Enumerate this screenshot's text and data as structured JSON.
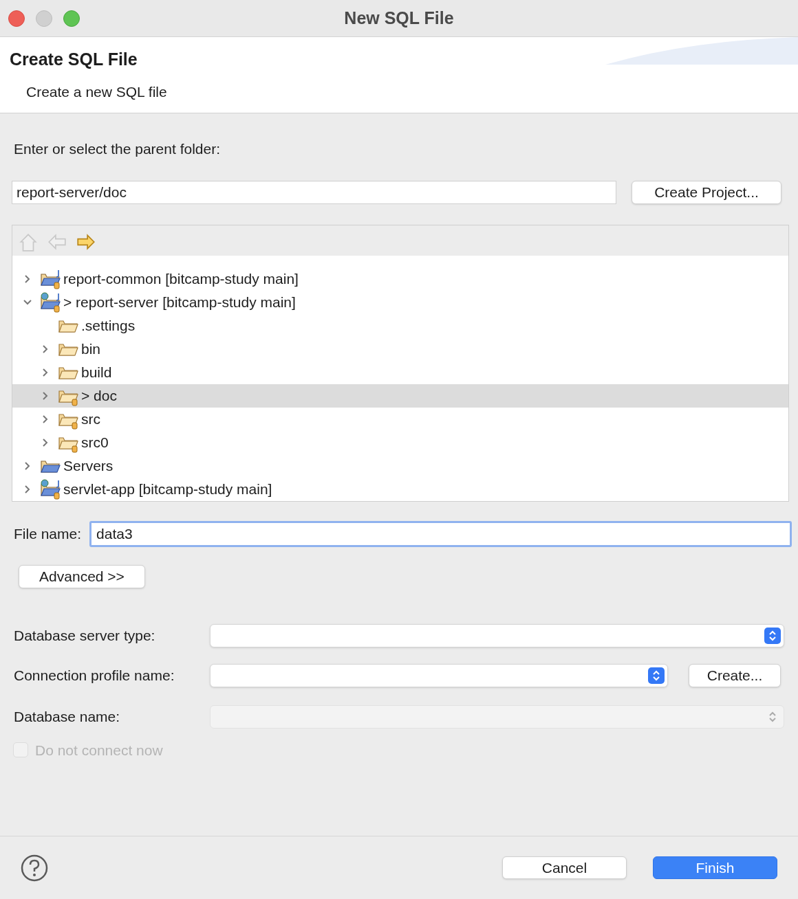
{
  "window": {
    "title": "New SQL File"
  },
  "header": {
    "title": "Create SQL File",
    "description": "Create a new SQL file"
  },
  "parent_folder": {
    "label": "Enter or select the parent folder:",
    "value": "report-server/doc",
    "button": "Create Project..."
  },
  "tree_toolbar": [
    {
      "kind": "home",
      "disabled": true
    },
    {
      "kind": "back",
      "disabled": true
    },
    {
      "kind": "forward",
      "disabled": false
    }
  ],
  "tree": [
    {
      "label": "report-common [bitcamp-study main]",
      "kind": "project",
      "expanded": false,
      "selected": false
    },
    {
      "label": "> report-server [bitcamp-study main]",
      "kind": "web-project",
      "expanded": true,
      "selected": false,
      "children": [
        {
          "label": ".settings",
          "kind": "folder",
          "selected": false
        },
        {
          "label": "bin",
          "kind": "folder",
          "expanded": false,
          "selected": false
        },
        {
          "label": "build",
          "kind": "folder",
          "expanded": false,
          "selected": false
        },
        {
          "label": "> doc",
          "kind": "source-folder",
          "expanded": false,
          "selected": true
        },
        {
          "label": "src",
          "kind": "source-folder",
          "expanded": false,
          "selected": false
        },
        {
          "label": "src0",
          "kind": "source-folder",
          "expanded": false,
          "selected": false
        }
      ]
    },
    {
      "label": "Servers",
      "kind": "servers",
      "expanded": false,
      "selected": false
    },
    {
      "label": "servlet-app [bitcamp-study main]",
      "kind": "web-project",
      "expanded": false,
      "selected": false
    }
  ],
  "file_name": {
    "label": "File name:",
    "value": "data3"
  },
  "advanced_button": "Advanced >>",
  "database_server_type": {
    "label": "Database server type:",
    "disabled": false
  },
  "connection_profile": {
    "label": "Connection profile name:",
    "disabled": false,
    "button": "Create..."
  },
  "database_name": {
    "label": "Database name:",
    "disabled": true
  },
  "do_not_connect": {
    "label": "Do not connect now",
    "checked": false,
    "disabled": true
  },
  "buttons": [
    {
      "label": "Cancel",
      "kind": "secondary"
    },
    {
      "label": "Finish",
      "kind": "primary"
    }
  ]
}
